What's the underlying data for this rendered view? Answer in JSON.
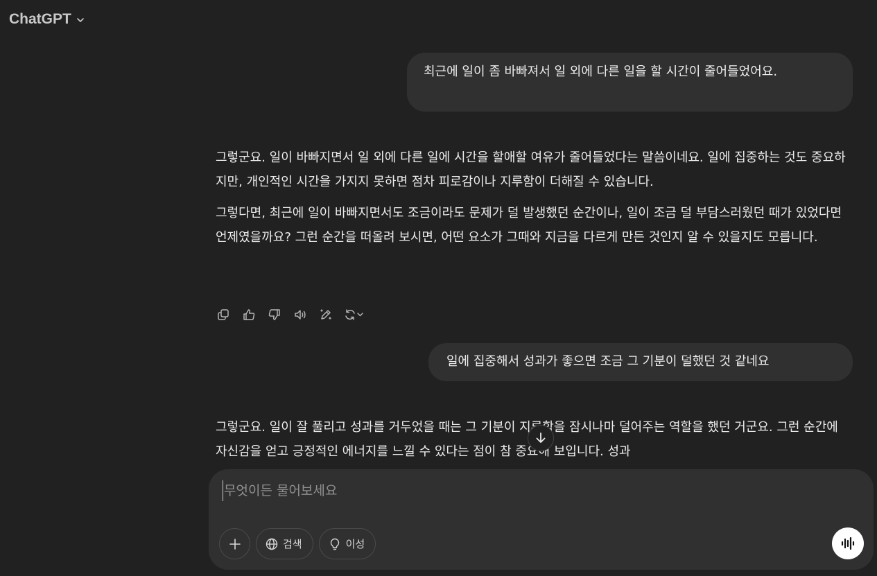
{
  "header": {
    "model_name": "ChatGPT"
  },
  "conversation": {
    "messages": [
      {
        "role": "user",
        "text": "최근에 일이 좀 바빠져서 일 외에 다른 일을 할 시간이 줄어들었어요."
      },
      {
        "role": "assistant",
        "paragraphs": [
          "그렇군요. 일이 바빠지면서 일 외에 다른 일에 시간을 할애할 여유가 줄어들었다는 말씀이네요. 일에 집중하는 것도 중요하지만, 개인적인 시간을 가지지 못하면 점차 피로감이나 지루함이 더해질 수 있습니다.",
          "그렇다면, 최근에 일이 바빠지면서도 조금이라도 문제가 덜 발생했던 순간이나, 일이 조금 덜 부담스러웠던 때가 있었다면 언제였을까요? 그런 순간을 떠올려 보시면, 어떤 요소가 그때와 지금을 다르게 만든 것인지 알 수 있을지도 모릅니다."
        ]
      },
      {
        "role": "user",
        "text": "일에 집중해서 성과가 좋으면 조금 그 기분이 덜했던 것 같네요"
      },
      {
        "role": "assistant",
        "paragraphs": [
          "그렇군요. 일이 잘 풀리고 성과를 거두었을 때는 그 기분이 지루함을 잠시나마 덜어주는 역할을 했던 거군요. 그런 순간에 자신감을 얻고 긍정적인 에너지를 느낄 수 있다는 점이 참 중요해 보입니다. 성과"
        ]
      }
    ],
    "actions": [
      "copy-icon",
      "thumbs-up-icon",
      "thumbs-down-icon",
      "read-aloud-icon",
      "edit-icon",
      "regenerate-icon"
    ]
  },
  "composer": {
    "placeholder": "무엇이든 물어보세요",
    "search_label": "검색",
    "reason_label": "이성"
  },
  "colors": {
    "background": "#212121",
    "bubble": "#303030",
    "text": "#ececec",
    "placeholder": "#8f8f8f"
  }
}
